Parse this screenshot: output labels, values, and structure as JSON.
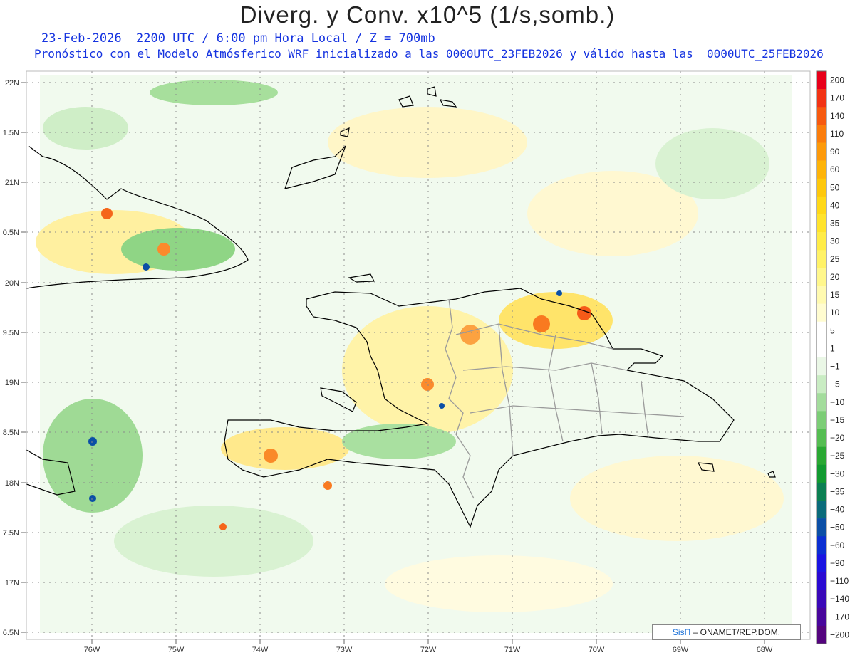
{
  "header": {
    "title": "Diverg. y Conv. x10^5 (1/s,somb.)",
    "line1": "23-Feb-2026  2200 UTC / 6:00 pm Hora Local / Z = 700mb",
    "line2": "Pronóstico con el Modelo Atmósferico WRF inicializado a las 0000UTC_23FEB2026 y válido hasta las  0000UTC_25FEB2026"
  },
  "axes": {
    "lat_labels": [
      "22N",
      "1.5N",
      "21N",
      "0.5N",
      "20N",
      "9.5N",
      "19N",
      "8.5N",
      "18N",
      "7.5N",
      "17N",
      "6.5N"
    ],
    "lon_labels": [
      "76W",
      "75W",
      "74W",
      "73W",
      "72W",
      "71W",
      "70W",
      "69W",
      "68W"
    ]
  },
  "colorbar": {
    "labels": [
      "200",
      "170",
      "140",
      "110",
      "90",
      "60",
      "50",
      "40",
      "35",
      "30",
      "25",
      "20",
      "15",
      "10",
      "5",
      "1",
      "−1",
      "−5",
      "−10",
      "−15",
      "−20",
      "−25",
      "−30",
      "−35",
      "−40",
      "−50",
      "−60",
      "−90",
      "−110",
      "−140",
      "−170",
      "−200"
    ],
    "colors": [
      "#e8001a",
      "#f23314",
      "#f75a10",
      "#fb7d0c",
      "#fd9a0a",
      "#feb409",
      "#fec80c",
      "#ffd818",
      "#ffe32c",
      "#ffec47",
      "#fff267",
      "#fff78c",
      "#fffab0",
      "#fffcd0",
      "#ffffff",
      "#ffffff",
      "#eaf7e6",
      "#c9ecc3",
      "#a3dc9c",
      "#7ccd76",
      "#55bd52",
      "#2aa833",
      "#129a30",
      "#0b7f52",
      "#0a6b7a",
      "#0b4fa6",
      "#0b2fd2",
      "#1a14e2",
      "#2a0ad2",
      "#3a08b8",
      "#48069c",
      "#54047e"
    ]
  },
  "credit": {
    "brand": "SisΠ",
    "text": "– ONAMET/REP.DOM."
  }
}
